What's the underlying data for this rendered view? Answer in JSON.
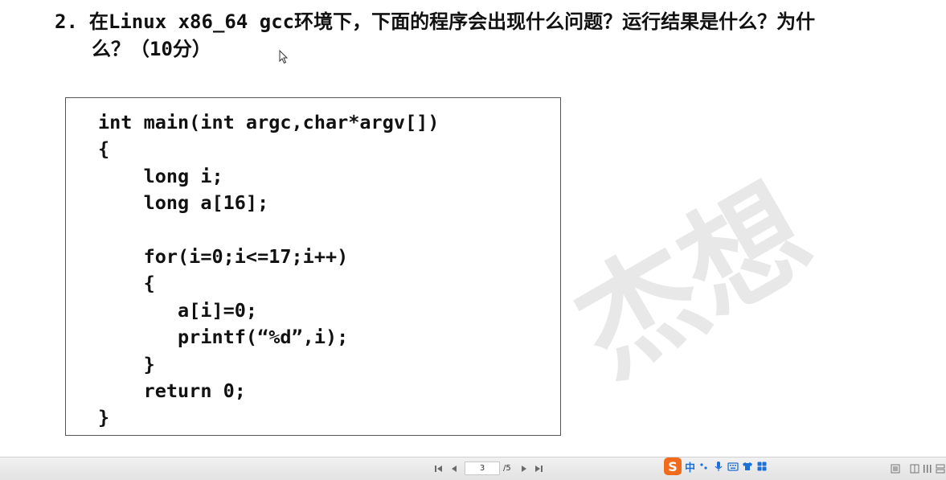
{
  "question": {
    "number": "2.",
    "text_line1": "在Linux x86_64 gcc环境下，下面的程序会出现什么问题？运行结果是什么？为什",
    "text_line2": "么？（10分）"
  },
  "code_lines": [
    "int main(int argc,char*argv[])",
    "{",
    "    long i;",
    "    long a[16];",
    "",
    "    for(i=0;i<=17;i++)",
    "    {",
    "       a[i]=0;",
    "       printf(“%d”,i);",
    "    }",
    "    return 0;",
    "}"
  ],
  "watermark": "杰想",
  "toolbar": {
    "current_page": "3",
    "page_total": "/5",
    "ime_logo": "S",
    "ime_mode": "中",
    "icons": [
      "first-page-icon",
      "prev-page-icon",
      "next-page-icon",
      "last-page-icon",
      "punctuation-icon",
      "microphone-icon",
      "keyboard-icon",
      "skin-icon",
      "toolbox-icon",
      "single-page-view-icon",
      "two-page-view-icon",
      "continuous-view-icon"
    ]
  },
  "colors": {
    "ime_orange": "#f26a1b",
    "ime_blue": "#1d6fd8",
    "toolbar_bg": "#e8e8e8"
  }
}
